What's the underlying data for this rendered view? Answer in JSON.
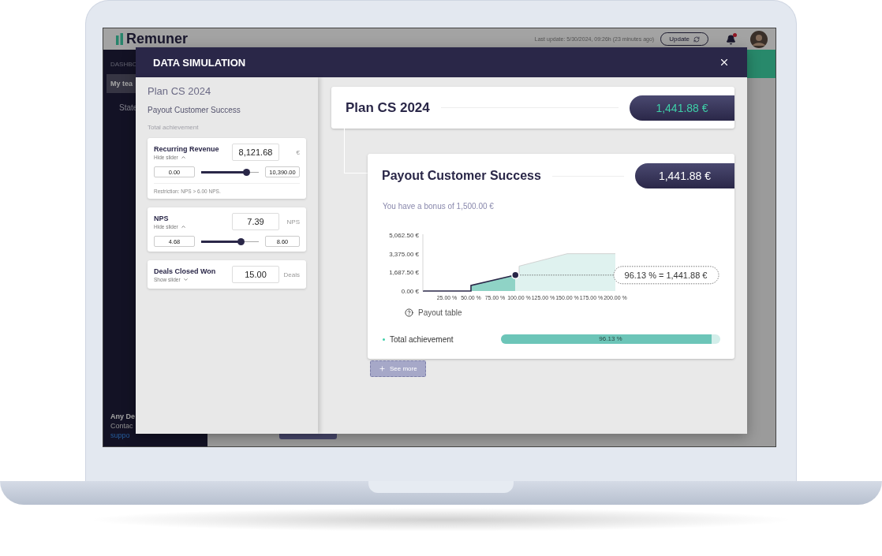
{
  "app": {
    "logo": "Remuner",
    "last_update": "Last update: 5/30/2024, 09:26h (23 minutes ago)",
    "update_button": "Update",
    "notifications": {
      "unread": true
    },
    "sidebar": {
      "section": "DASHBO",
      "items": [
        {
          "label": "My tea",
          "selected": true
        },
        {
          "label": "State",
          "selected": false
        }
      ],
      "help": {
        "title": "Any De",
        "text": "Contac",
        "link": "suppo"
      }
    }
  },
  "modal": {
    "title": "DATA SIMULATION",
    "panel": {
      "plan": "Plan CS 2024",
      "payout": "Payout Customer Success",
      "section": "Total achievement",
      "variables": [
        {
          "name": "Recurring Revenue",
          "toggle": "Hide slider",
          "expanded": true,
          "value": "8,121.68",
          "unit": "€",
          "min": "0.00",
          "max": "10,390.00",
          "level": 0.78,
          "note": "Restriction: NPS > 6.00 NPS."
        },
        {
          "name": "NPS",
          "toggle": "Hide slider",
          "expanded": true,
          "value": "7.39",
          "unit": "NPS",
          "min": "4.68",
          "max": "8.60",
          "level": 0.69
        },
        {
          "name": "Deals Closed Won",
          "toggle": "Show slider",
          "expanded": false,
          "value": "15.00",
          "unit": "Deals"
        }
      ]
    },
    "plan_card": {
      "title": "Plan CS 2024",
      "amount": "1,441.88 €",
      "highlighted": true
    },
    "payout_card": {
      "title": "Payout Customer Success",
      "amount": "1,441.88 €",
      "highlighted": false,
      "bonus": "You have a bonus of 1,500.00 €",
      "chart_data": {
        "type": "area",
        "x": [
          0,
          50,
          50,
          96.13,
          100,
          100,
          150,
          200
        ],
        "xlim": [
          0,
          200
        ],
        "ylim": [
          0,
          5062.5
        ],
        "xticks": [
          {
            "value": 25,
            "label": "25.00 %"
          },
          {
            "value": 50,
            "label": "50.00 %"
          },
          {
            "value": 75,
            "label": "75.00 %"
          },
          {
            "value": 100,
            "label": "100.00 %"
          },
          {
            "value": 125,
            "label": "125.00 %"
          },
          {
            "value": 150,
            "label": "150.00 %"
          },
          {
            "value": 175,
            "label": "175.00 %"
          },
          {
            "value": 200,
            "label": "200.00 %"
          }
        ],
        "yticks": [
          {
            "value": 0,
            "label": "0.00 €"
          },
          {
            "value": 1687.5,
            "label": "1,687.50 €"
          },
          {
            "value": 3375,
            "label": "3,375.00 €"
          },
          {
            "value": 5062.5,
            "label": "5,062.50 €"
          }
        ],
        "series": [
          {
            "color": "#8fd3c6",
            "values": [
              0,
              0,
              500,
              1440,
              null,
              null,
              null,
              null
            ]
          },
          {
            "color": "#dff2ef",
            "values": [
              null,
              null,
              null,
              1440,
              1440,
              2250,
              3375,
              3375
            ]
          }
        ],
        "annotations": [
          {
            "x": 96.13,
            "y": 1440,
            "text": "96.13 % = 1,441.88 €"
          }
        ]
      },
      "payout_table": "Payout table",
      "achievement": {
        "label": "Total achievement",
        "level": 0.9613,
        "reading": "96.13 %"
      }
    },
    "see_more": "See more"
  }
}
